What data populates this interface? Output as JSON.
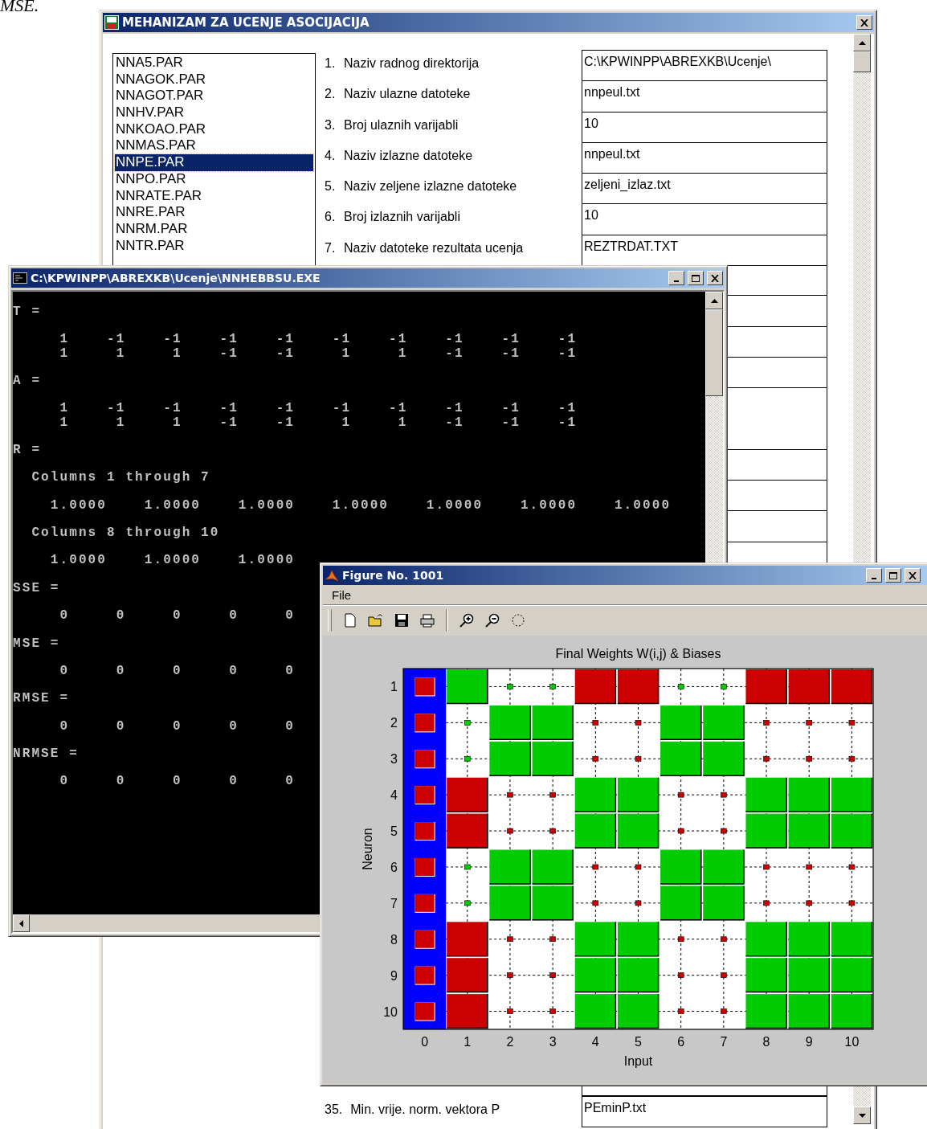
{
  "page_text": "MSE.",
  "main_window": {
    "title": "MEHANIZAM ZA UCENJE ASOCIJACIJA",
    "files": [
      {
        "name": "NNA5.PAR",
        "selected": false
      },
      {
        "name": "NNAGOK.PAR",
        "selected": false
      },
      {
        "name": "NNAGOT.PAR",
        "selected": false
      },
      {
        "name": "NNHV.PAR",
        "selected": false
      },
      {
        "name": "NNKOAO.PAR",
        "selected": false
      },
      {
        "name": "NNMAS.PAR",
        "selected": false
      },
      {
        "name": "NNPE.PAR",
        "selected": true
      },
      {
        "name": "NNPO.PAR",
        "selected": false
      },
      {
        "name": "NNRATE.PAR",
        "selected": false
      },
      {
        "name": "NNRE.PAR",
        "selected": false
      },
      {
        "name": "NNRM.PAR",
        "selected": false
      },
      {
        "name": "NNTR.PAR",
        "selected": false
      }
    ],
    "parameters": [
      {
        "number": "1.",
        "label": "Naziv radnog direktorija",
        "value": "C:\\KPWINPP\\ABREXKB\\Ucenje\\"
      },
      {
        "number": "2.",
        "label": "Naziv ulazne datoteke",
        "value": "nnpeul.txt"
      },
      {
        "number": "3.",
        "label": "Broj ulaznih varijabli",
        "value": "10"
      },
      {
        "number": "4.",
        "label": "Naziv izlazne datoteke",
        "value": "nnpeul.txt"
      },
      {
        "number": "5.",
        "label": "Naziv zeljene izlazne datoteke",
        "value": "zeljeni_izlaz.txt"
      },
      {
        "number": "6.",
        "label": "Broj izlaznih varijabli",
        "value": "10"
      },
      {
        "number": "7.",
        "label": "Naziv datoteke rezultata ucenja",
        "value": "REZTRDAT.TXT"
      },
      {
        "number": "35.",
        "label": "Min. vrije. norm. vektora P",
        "value": "PEminP.txt"
      }
    ]
  },
  "console_window": {
    "title": "C:\\KPWINPP\\ABREXKB\\Ucenje\\NNHEBBSU.EXE",
    "blocks": [
      {
        "label": "T =",
        "rows": [
          "     1    -1    -1    -1    -1    -1    -1    -1    -1    -1",
          "     1     1     1    -1    -1     1     1    -1    -1    -1"
        ]
      },
      {
        "label": "A =",
        "rows": [
          "     1    -1    -1    -1    -1    -1    -1    -1    -1    -1",
          "     1     1     1    -1    -1     1     1    -1    -1    -1"
        ]
      },
      {
        "label": "R =",
        "parts": [
          {
            "heading": "  Columns 1 through 7",
            "rows": [
              "    1.0000    1.0000    1.0000    1.0000    1.0000    1.0000    1.0000"
            ]
          },
          {
            "heading": "  Columns 8 through 10",
            "rows": [
              "    1.0000    1.0000    1.0000"
            ]
          }
        ]
      },
      {
        "label": "SSE =",
        "rows": [
          "     0     0     0     0     0"
        ]
      },
      {
        "label": "MSE =",
        "rows": [
          "     0     0     0     0     0"
        ]
      },
      {
        "label": "RMSE =",
        "rows": [
          "     0     0     0     0     0"
        ]
      },
      {
        "label": "NRMSE =",
        "rows": [
          "     0     0     0     0     0"
        ]
      }
    ]
  },
  "figure_window": {
    "title": "Figure No. 1001",
    "menu": [
      "File"
    ],
    "plot": {
      "title": "Final Weights W(i,j) & Biases",
      "xlabel": "Input",
      "ylabel": "Neuron",
      "xticks": [
        "0",
        "1",
        "2",
        "3",
        "4",
        "5",
        "6",
        "7",
        "8",
        "9",
        "10"
      ],
      "rows": [
        {
          "label": "1",
          "bias_positive": false,
          "cells": [
            {
              "positive": true,
              "large": true
            },
            {
              "positive": true,
              "large": false
            },
            {
              "positive": true,
              "large": false
            },
            {
              "positive": false,
              "large": true
            },
            {
              "positive": false,
              "large": true
            },
            {
              "positive": true,
              "large": false
            },
            {
              "positive": true,
              "large": false
            },
            {
              "positive": false,
              "large": true
            },
            {
              "positive": false,
              "large": true
            },
            {
              "positive": false,
              "large": true
            }
          ]
        },
        {
          "label": "2",
          "bias_positive": false,
          "cells": [
            {
              "positive": true,
              "large": false
            },
            {
              "positive": true,
              "large": true
            },
            {
              "positive": true,
              "large": true
            },
            {
              "positive": false,
              "large": false
            },
            {
              "positive": false,
              "large": false
            },
            {
              "positive": true,
              "large": true
            },
            {
              "positive": true,
              "large": true
            },
            {
              "positive": false,
              "large": false
            },
            {
              "positive": false,
              "large": false
            },
            {
              "positive": false,
              "large": false
            }
          ]
        },
        {
          "label": "3",
          "bias_positive": false,
          "cells": [
            {
              "positive": true,
              "large": false
            },
            {
              "positive": true,
              "large": true
            },
            {
              "positive": true,
              "large": true
            },
            {
              "positive": false,
              "large": false
            },
            {
              "positive": false,
              "large": false
            },
            {
              "positive": true,
              "large": true
            },
            {
              "positive": true,
              "large": true
            },
            {
              "positive": false,
              "large": false
            },
            {
              "positive": false,
              "large": false
            },
            {
              "positive": false,
              "large": false
            }
          ]
        },
        {
          "label": "4",
          "bias_positive": false,
          "cells": [
            {
              "positive": false,
              "large": true
            },
            {
              "positive": false,
              "large": false
            },
            {
              "positive": false,
              "large": false
            },
            {
              "positive": true,
              "large": true
            },
            {
              "positive": true,
              "large": true
            },
            {
              "positive": false,
              "large": false
            },
            {
              "positive": false,
              "large": false
            },
            {
              "positive": true,
              "large": true
            },
            {
              "positive": true,
              "large": true
            },
            {
              "positive": true,
              "large": true
            }
          ]
        },
        {
          "label": "5",
          "bias_positive": false,
          "cells": [
            {
              "positive": false,
              "large": true
            },
            {
              "positive": false,
              "large": false
            },
            {
              "positive": false,
              "large": false
            },
            {
              "positive": true,
              "large": true
            },
            {
              "positive": true,
              "large": true
            },
            {
              "positive": false,
              "large": false
            },
            {
              "positive": false,
              "large": false
            },
            {
              "positive": true,
              "large": true
            },
            {
              "positive": true,
              "large": true
            },
            {
              "positive": true,
              "large": true
            }
          ]
        },
        {
          "label": "6",
          "bias_positive": false,
          "cells": [
            {
              "positive": true,
              "large": false
            },
            {
              "positive": true,
              "large": true
            },
            {
              "positive": true,
              "large": true
            },
            {
              "positive": false,
              "large": false
            },
            {
              "positive": false,
              "large": false
            },
            {
              "positive": true,
              "large": true
            },
            {
              "positive": true,
              "large": true
            },
            {
              "positive": false,
              "large": false
            },
            {
              "positive": false,
              "large": false
            },
            {
              "positive": false,
              "large": false
            }
          ]
        },
        {
          "label": "7",
          "bias_positive": false,
          "cells": [
            {
              "positive": true,
              "large": false
            },
            {
              "positive": true,
              "large": true
            },
            {
              "positive": true,
              "large": true
            },
            {
              "positive": false,
              "large": false
            },
            {
              "positive": false,
              "large": false
            },
            {
              "positive": true,
              "large": true
            },
            {
              "positive": true,
              "large": true
            },
            {
              "positive": false,
              "large": false
            },
            {
              "positive": false,
              "large": false
            },
            {
              "positive": false,
              "large": false
            }
          ]
        },
        {
          "label": "8",
          "bias_positive": false,
          "cells": [
            {
              "positive": false,
              "large": true
            },
            {
              "positive": false,
              "large": false
            },
            {
              "positive": false,
              "large": false
            },
            {
              "positive": true,
              "large": true
            },
            {
              "positive": true,
              "large": true
            },
            {
              "positive": false,
              "large": false
            },
            {
              "positive": false,
              "large": false
            },
            {
              "positive": true,
              "large": true
            },
            {
              "positive": true,
              "large": true
            },
            {
              "positive": true,
              "large": true
            }
          ]
        },
        {
          "label": "9",
          "bias_positive": false,
          "cells": [
            {
              "positive": false,
              "large": true
            },
            {
              "positive": false,
              "large": false
            },
            {
              "positive": false,
              "large": false
            },
            {
              "positive": true,
              "large": true
            },
            {
              "positive": true,
              "large": true
            },
            {
              "positive": false,
              "large": false
            },
            {
              "positive": false,
              "large": false
            },
            {
              "positive": true,
              "large": true
            },
            {
              "positive": true,
              "large": true
            },
            {
              "positive": true,
              "large": true
            }
          ]
        },
        {
          "label": "10",
          "bias_positive": false,
          "cells": [
            {
              "positive": false,
              "large": true
            },
            {
              "positive": false,
              "large": false
            },
            {
              "positive": false,
              "large": false
            },
            {
              "positive": true,
              "large": true
            },
            {
              "positive": true,
              "large": true
            },
            {
              "positive": false,
              "large": false
            },
            {
              "positive": false,
              "large": false
            },
            {
              "positive": true,
              "large": true
            },
            {
              "positive": true,
              "large": true
            },
            {
              "positive": true,
              "large": true
            }
          ]
        }
      ]
    }
  }
}
